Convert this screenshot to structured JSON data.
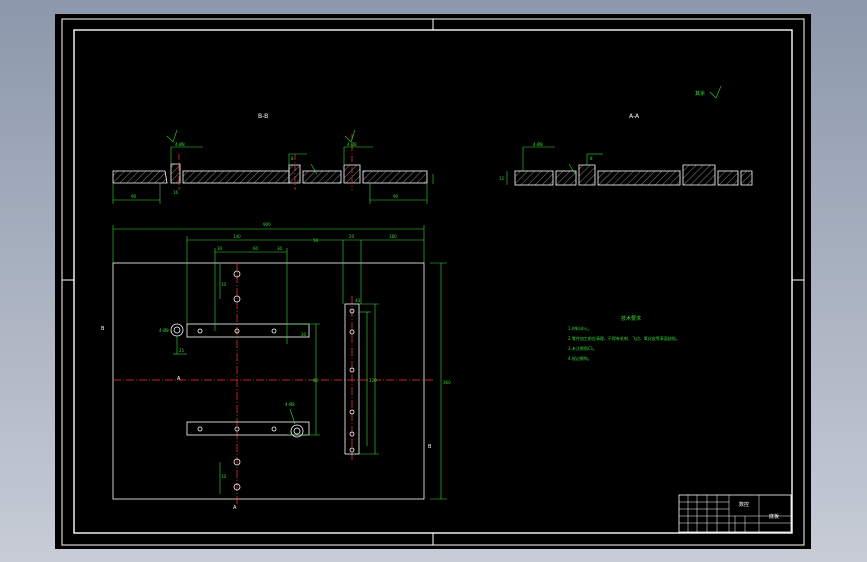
{
  "drawing": {
    "section_label_left": "B-B",
    "section_label_right": "A-A",
    "roughness_note": "其余",
    "top_label_a": "A",
    "bottom_label_a": "A",
    "side_label_b_left": "B",
    "side_label_b_right": "B",
    "dimensions": {
      "overall_width": "900",
      "overall_height": "360",
      "d_140": "140",
      "d_50": "50",
      "d_20": "20",
      "d_180": "180",
      "d_30a": "30",
      "d_60": "60",
      "d_30b": "30",
      "d_80": "80",
      "d_90": "90",
      "d_30v": "30",
      "d_120": "120",
      "d_12": "12",
      "d_40": "40",
      "d_25": "25",
      "d_10": "10",
      "d_42": "4-Ø8",
      "d_8": "8",
      "d_16": "16"
    },
    "tech_requirements": {
      "title": "技术要求",
      "lines": [
        "1.材料淬火。",
        "2.零件加工前应清理，不得有毛刺、飞边、氧化皮等表面缺陷。",
        "3.未注倒角C1。",
        "4.锐边倒钝。"
      ]
    },
    "title_block": {
      "name": "底板",
      "drawing_no": "数控"
    }
  },
  "colors": {
    "background": "#000000",
    "frame": "#ffffff",
    "outline": "#ffffff",
    "dimension": "#33dd33",
    "centerline": "#ff3333",
    "hatch": "#ffffff"
  }
}
